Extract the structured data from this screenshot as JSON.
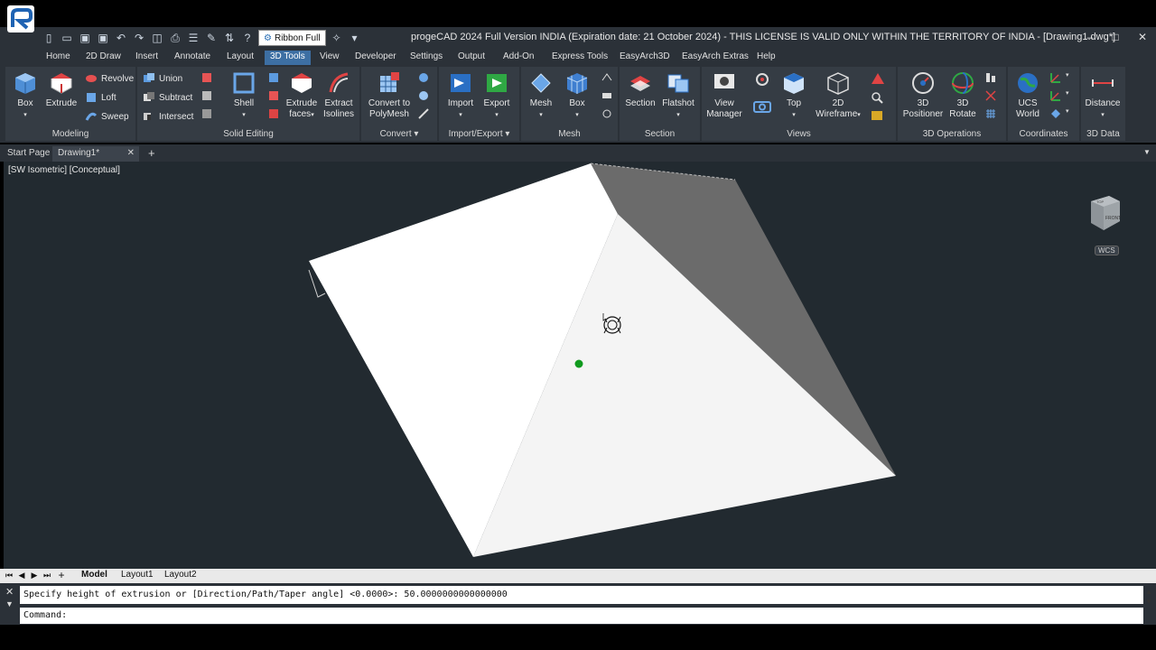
{
  "window": {
    "title": "progeCAD 2024 Full Version INDIA  (Expiration date: 21 October 2024) - THIS LICENSE IS VALID ONLY WITHIN THE TERRITORY OF INDIA - [Drawing1.dwg*]",
    "minimize": "‒",
    "maximize": "□",
    "close": "✕"
  },
  "qat": {
    "ribbon_style": "Ribbon Full"
  },
  "menu_tabs": [
    "Home",
    "2D Draw",
    "Insert",
    "Annotate",
    "Layout",
    "3D Tools",
    "View",
    "Developer",
    "Settings",
    "Output",
    "Add-On",
    "Express Tools",
    "EasyArch3D",
    "EasyArch Extras",
    "Help"
  ],
  "active_menu_tab": "3D Tools",
  "ribbon": {
    "modeling": {
      "title": "Modeling",
      "box": "Box",
      "extrude": "Extrude",
      "revolve": "Revolve",
      "loft": "Loft",
      "sweep": "Sweep"
    },
    "solid_editing": {
      "title": "Solid Editing",
      "union": "Union",
      "subtract": "Subtract",
      "intersect": "Intersect",
      "shell": "Shell",
      "extrude_faces_1": "Extrude",
      "extrude_faces_2": "faces",
      "extract_isolines_1": "Extract",
      "extract_isolines_2": "Isolines"
    },
    "convert": {
      "title": "Convert",
      "label_1": "Convert to",
      "label_2": "PolyMesh"
    },
    "import_export": {
      "title": "Import/Export",
      "import": "Import",
      "export": "Export"
    },
    "mesh": {
      "title": "Mesh",
      "mesh": "Mesh",
      "box": "Box"
    },
    "section": {
      "title": "Section",
      "section": "Section",
      "flatshot": "Flatshot"
    },
    "views": {
      "title": "Views",
      "view_manager_1": "View",
      "view_manager_2": "Manager",
      "top": "Top",
      "wireframe_1": "2D",
      "wireframe_2": "Wireframe"
    },
    "operations": {
      "title": "3D Operations",
      "positioner_1": "3D",
      "positioner_2": "Positioner",
      "rotate_1": "3D",
      "rotate_2": "Rotate"
    },
    "coordinates": {
      "title": "Coordinates",
      "ucs_1": "UCS",
      "ucs_2": "World"
    },
    "data3d": {
      "title": "3D Data",
      "distance": "Distance"
    }
  },
  "doc_tabs": {
    "start": "Start Page",
    "drawing": "Drawing1*",
    "close": "✕",
    "add": "+"
  },
  "viewport": {
    "label": "[SW Isometric]  [Conceptual]",
    "viewcube_top": "TOP",
    "viewcube_front": "FRONT",
    "wcs": "WCS"
  },
  "layout_tabs": {
    "model": "Model",
    "layout1": "Layout1",
    "layout2": "Layout2"
  },
  "command": {
    "history": "Specify height of extrusion or [Direction/Path/Taper angle] <0.0000>: 50.0000000000000000",
    "prompt": "Command:"
  },
  "colors": {
    "accent": "#3d6fa3",
    "background": "#222a30",
    "ribbon": "#2b3138"
  }
}
